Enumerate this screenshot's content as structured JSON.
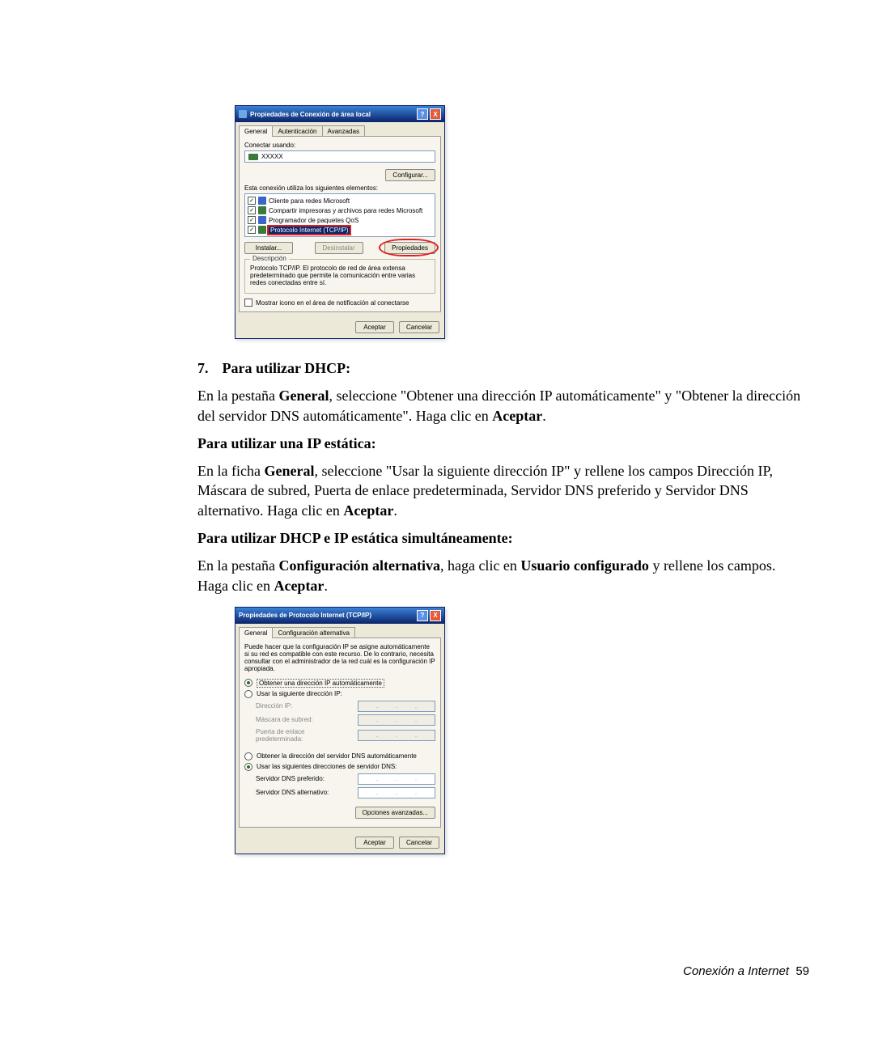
{
  "dialog1": {
    "title": "Propiedades de Conexión de área local",
    "tabs": [
      "General",
      "Autenticación",
      "Avanzadas"
    ],
    "connect_using_label": "Conectar usando:",
    "adapter": "XXXXX",
    "configure_btn": "Configurar...",
    "elements_label": "Esta conexión utiliza los siguientes elementos:",
    "items": [
      "Cliente para redes Microsoft",
      "Compartir impresoras y archivos para redes Microsoft",
      "Programador de paquetes QoS",
      "Protocolo Internet (TCP/IP)"
    ],
    "install_btn": "Instalar...",
    "uninstall_btn": "Desinstalar",
    "properties_btn": "Propiedades",
    "desc_label": "Descripción",
    "desc_text": "Protocolo TCP/IP. El protocolo de red de área extensa predeterminado que permite la comunicación entre varias redes conectadas entre sí.",
    "show_icon": "Mostrar icono en el área de notificación al conectarse",
    "ok": "Aceptar",
    "cancel": "Cancelar"
  },
  "instructions": {
    "step_num": "7.",
    "dhcp_title": "Para utilizar DHCP:",
    "dhcp_text_1": "En la pestaña ",
    "dhcp_bold_1": "General",
    "dhcp_text_2": ", seleccione \"Obtener una dirección IP automáticamente\" y \"Obtener la dirección del servidor DNS automáticamente\". Haga clic en ",
    "dhcp_bold_2": "Aceptar",
    "dhcp_text_3": ".",
    "static_title": "Para utilizar una IP estática:",
    "static_text_1": "En la ficha ",
    "static_bold_1": "General",
    "static_text_2": ", seleccione \"Usar la siguiente dirección IP\" y rellene los campos Dirección IP, Máscara de subred, Puerta de enlace predeterminada, Servidor DNS preferido y Servidor DNS alternativo. Haga clic en ",
    "static_bold_2": "Aceptar",
    "static_text_3": ".",
    "both_title": "Para utilizar DHCP e IP estática simultáneamente:",
    "both_text_1": "En la pestaña ",
    "both_bold_1": "Configuración alternativa",
    "both_text_2": ", haga clic en ",
    "both_bold_2": "Usuario configurado",
    "both_text_3": " y rellene los campos. Haga clic en ",
    "both_bold_3": "Aceptar",
    "both_text_4": "."
  },
  "dialog2": {
    "title": "Propiedades de Protocolo Internet (TCP/IP)",
    "tabs": [
      "General",
      "Configuración alternativa"
    ],
    "intro": "Puede hacer que la configuración IP se asigne automáticamente si su red es compatible con este recurso. De lo contrario, necesita consultar con el administrador de la red cuál es la configuración IP apropiada.",
    "radio_auto_ip": "Obtener una dirección IP automáticamente",
    "radio_static_ip": "Usar la siguiente dirección IP:",
    "ip_label": "Dirección IP:",
    "mask_label": "Máscara de subred:",
    "gw_label": "Puerta de enlace predeterminada:",
    "radio_auto_dns": "Obtener la dirección del servidor DNS automáticamente",
    "radio_static_dns": "Usar las siguientes direcciones de servidor DNS:",
    "dns_pref_label": "Servidor DNS preferido:",
    "dns_alt_label": "Servidor DNS alternativo:",
    "advanced_btn": "Opciones avanzadas...",
    "ok": "Aceptar",
    "cancel": "Cancelar"
  },
  "footer": {
    "text": "Conexión a Internet",
    "page": "59"
  }
}
